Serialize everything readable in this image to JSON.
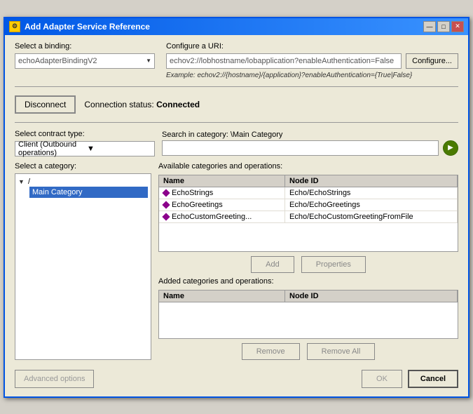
{
  "window": {
    "title": "Add Adapter Service Reference",
    "icon": "⚙"
  },
  "titleControls": {
    "minimize": "—",
    "maximize": "□",
    "close": "✕"
  },
  "binding": {
    "label": "Select a binding:",
    "value": "echoAdapterBindingV2"
  },
  "uri": {
    "label": "Configure a URI:",
    "value": "echov2://lobhostname/lobapplication?enableAuthentication=False",
    "example": "Example: echov2://{hostname}/{application}?enableAuthentication={True|False}",
    "configureBtn": "Configure..."
  },
  "connection": {
    "disconnectBtn": "Disconnect",
    "statusLabel": "Connection status:",
    "statusValue": "Connected"
  },
  "contract": {
    "label": "Select contract type:",
    "value": "Client (Outbound operations)"
  },
  "search": {
    "label": "Search in category: \\Main Category",
    "placeholder": "",
    "goBtn": "▶"
  },
  "categoryPanel": {
    "label": "Select a category:",
    "tree": {
      "root": "/",
      "children": [
        "Main Category"
      ]
    }
  },
  "operationsPanel": {
    "label": "Available categories and operations:",
    "columns": [
      "Name",
      "Node ID"
    ],
    "rows": [
      {
        "name": "EchoStrings",
        "nodeId": "Echo/EchoStrings"
      },
      {
        "name": "EchoGreetings",
        "nodeId": "Echo/EchoGreetings"
      },
      {
        "name": "EchoCustomGreeting...",
        "nodeId": "Echo/EchoCustomGreetingFromFile"
      }
    ],
    "addBtn": "Add",
    "propertiesBtn": "Properties"
  },
  "addedPanel": {
    "label": "Added categories and operations:",
    "columns": [
      "Name",
      "Node ID"
    ],
    "rows": [],
    "removeBtn": "Remove",
    "removeAllBtn": "Remove All"
  },
  "footer": {
    "advancedBtn": "Advanced options",
    "okBtn": "OK",
    "cancelBtn": "Cancel"
  }
}
